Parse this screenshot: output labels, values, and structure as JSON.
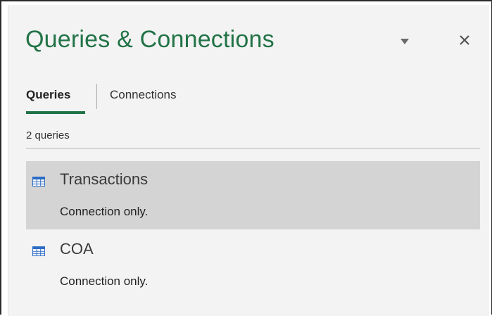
{
  "pane": {
    "title": "Queries & Connections",
    "menu_icon": "chevron-down-icon",
    "close_icon": "close-icon"
  },
  "tabs": [
    {
      "label": "Queries",
      "active": true
    },
    {
      "label": "Connections",
      "active": false
    }
  ],
  "query_count_label": "2 queries",
  "queries": [
    {
      "name": "Transactions",
      "status": "Connection only.",
      "icon": "table-icon",
      "selected": true
    },
    {
      "name": "COA",
      "status": "Connection only.",
      "icon": "table-icon",
      "selected": false
    }
  ],
  "colors": {
    "accent": "#217346",
    "pane_bg": "#f3f3f3",
    "selected_bg": "#d4d4d4",
    "icon_blue": "#2b6cc4"
  }
}
